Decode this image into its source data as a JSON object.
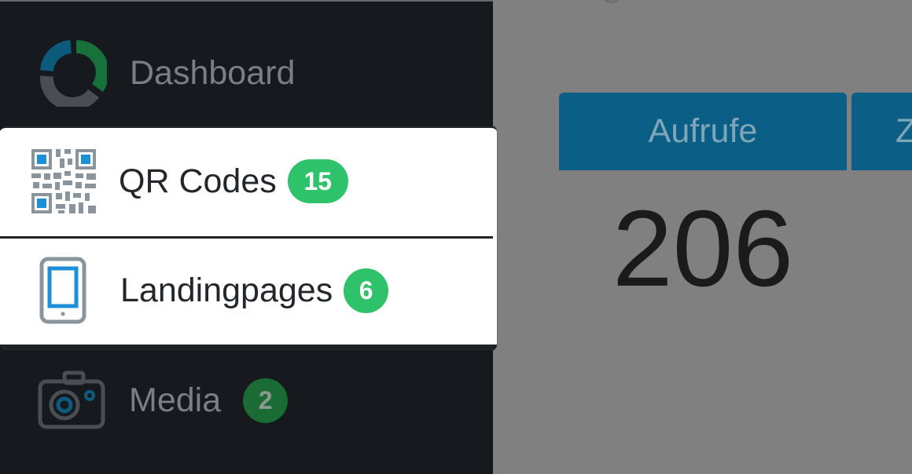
{
  "sidebar": {
    "items": [
      {
        "label": "Dashboard",
        "icon": "dashboard-donut-icon",
        "state": "dimmed"
      },
      {
        "label": "QR Codes",
        "badge": "15",
        "icon": "qr-code-icon",
        "state": "highlighted"
      },
      {
        "label": "Landingpages",
        "badge": "6",
        "icon": "smartphone-icon",
        "state": "highlighted"
      },
      {
        "label": "Media",
        "badge": "2",
        "icon": "camera-icon",
        "state": "dimmed"
      }
    ]
  },
  "main": {
    "tabs": [
      {
        "label": "Aufrufe"
      },
      {
        "label": "Z"
      }
    ],
    "stat_value": "206"
  },
  "colors": {
    "sidebar_bg": "#161a1f",
    "overlay_bg": "#808080",
    "badge_green": "#2ec26a",
    "tab_blue": "#0b5f86",
    "icon_blue": "#1c8fd6",
    "icon_grey": "#8a949c"
  }
}
